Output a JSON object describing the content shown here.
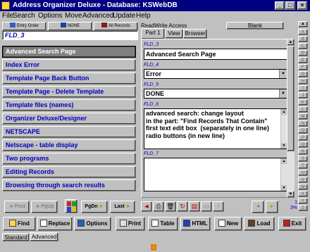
{
  "window": {
    "title": "Address Organizer Deluxe - Database: KSWebDB",
    "controls": {
      "minimize": "_",
      "maximize": "□",
      "close": "×"
    }
  },
  "menu": [
    "File",
    "Search",
    "Options",
    "Move",
    "Advanced",
    "Update",
    "Help"
  ],
  "filter_toolbar": {
    "entry_order": "Entry Order",
    "none": "NONE",
    "all_records": "All Records"
  },
  "record_id": "FLD_3",
  "records": [
    "Advanced Search Page",
    "Index Error",
    "Template Page Back Button",
    "Template Page - Delete Template",
    "Template files (names)",
    "Organizer Deluxe/Designer",
    "NETSCAPE",
    "Netscape - table display",
    "Two programs",
    "Editing Records",
    "Browsing through search results"
  ],
  "selected_record_index": 0,
  "access_mode": "ReadWrite Access",
  "blank_button": "Blank",
  "tabs": [
    "Part 1",
    "View",
    "Browser"
  ],
  "active_tab": "Part 1",
  "fields": {
    "fld3": {
      "label": "FLD_3",
      "value": "Advanced Search Page"
    },
    "fld4": {
      "label": "FLD_4",
      "value": "Error"
    },
    "fld5": {
      "label": "FLD_5",
      "value": "DONE"
    },
    "fld6": {
      "label": "FLD_6",
      "value": "advanced search: change layout\nin the part: \"Find Records That Contain\"\nfirst text edit box  (separately in one line)\nradio buttons (in new line)"
    },
    "fld7": {
      "label": "FLD_7",
      "value": ""
    }
  },
  "alphabet": [
    "A",
    "B",
    "C",
    "D",
    "E",
    "F",
    "G",
    "H",
    "I",
    "J",
    "K",
    "L",
    "M",
    "N",
    "O",
    "P",
    "Q",
    "R",
    "S",
    "T",
    "U",
    "V",
    "W",
    "X",
    "Y",
    "Z"
  ],
  "nav": {
    "first": "First",
    "pgup": "PgUp",
    "pgdn": "PgDn",
    "last": "Last"
  },
  "page_counter": {
    "current": "1",
    "percent": "3%"
  },
  "bottom_buttons": {
    "find": "Find",
    "replace": "Replace",
    "options": "Options",
    "print": "Print",
    "table": "Table",
    "html": "HTML",
    "new": "New",
    "load": "Load",
    "exit": "Exit"
  },
  "mode_tabs": [
    "Standard",
    "Advanced"
  ],
  "active_mode_tab": "Advanced",
  "colors": {
    "titlebar": "#000080",
    "record_text": "#0000c0",
    "face": "#c0c0c0"
  }
}
